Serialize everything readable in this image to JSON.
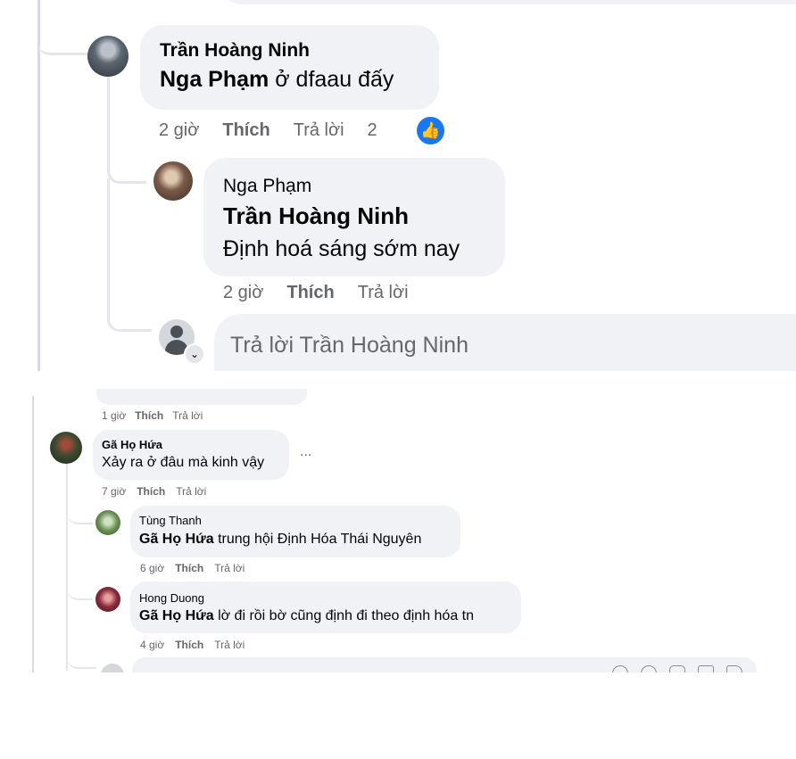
{
  "top": {
    "thread1": {
      "author": "Trần Hoàng Ninh",
      "tag": "Nga Phạm",
      "text": "ở dfaau đấy",
      "time": "2 giờ",
      "like": "Thích",
      "reply": "Trả lời",
      "reaction_count": "2"
    },
    "thread2": {
      "author": "Nga Phạm",
      "tag": "Trần Hoàng Ninh",
      "text": "Định hoá sáng sớm nay",
      "time": "2 giờ",
      "like": "Thích",
      "reply": "Trả lời"
    },
    "reply_placeholder": "Trả lời Trần Hoàng Ninh"
  },
  "bottom": {
    "prev_meta": {
      "time": "1 giờ",
      "like": "Thích",
      "reply": "Trả lời"
    },
    "c1": {
      "author": "Gã Họ Hứa",
      "text": "Xảy ra ở đâu mà kinh vậy",
      "more": "...",
      "time": "7 giờ",
      "like": "Thích",
      "reply": "Trả lời"
    },
    "c2": {
      "author": "Tùng Thanh",
      "tag": "Gã Họ Hứa",
      "text": "trung hội Định Hóa Thái Nguyên",
      "time": "6 giờ",
      "like": "Thích",
      "reply": "Trả lời"
    },
    "c3": {
      "author": "Hong Duong",
      "tag": "Gã Họ Hứa",
      "text": "lờ đi rồi bờ cũng định đi theo định hóa tn",
      "time": "4 giờ",
      "like": "Thích",
      "reply": "Trả lời"
    }
  },
  "colors": {
    "bubble": "#f0f2f5",
    "meta": "#65676b",
    "like_blue": "#1877f2",
    "line": "#e4e6eb"
  }
}
